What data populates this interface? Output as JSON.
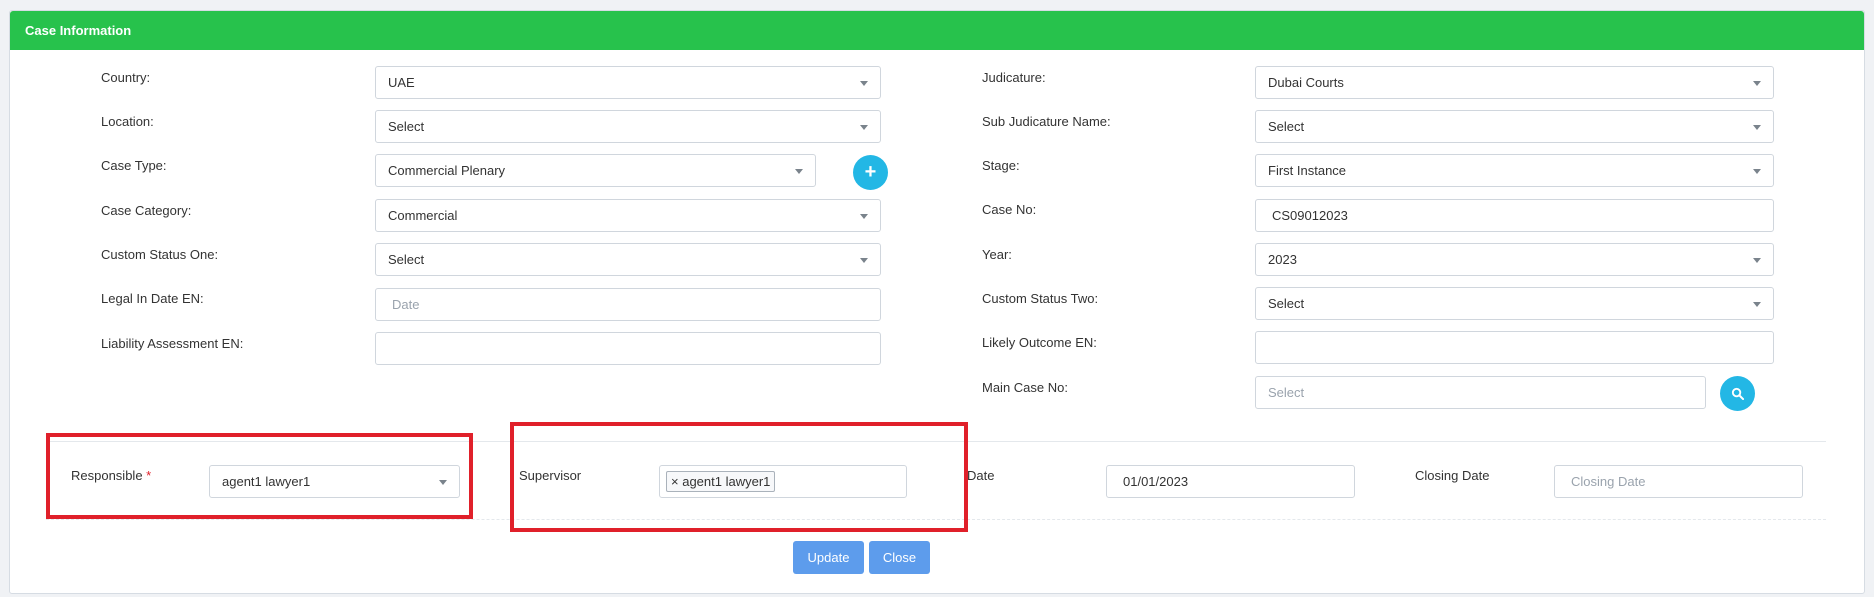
{
  "panel": {
    "title": "Case Information"
  },
  "left_fields": [
    {
      "label": "Country:",
      "value": "UAE",
      "type": "select"
    },
    {
      "label": "Location:",
      "value": "Select",
      "type": "select"
    },
    {
      "label": "Case Type:",
      "value": "Commercial Plenary",
      "type": "select"
    },
    {
      "label": "Case Category:",
      "value": "Commercial",
      "type": "select"
    },
    {
      "label": "Custom Status One:",
      "value": "Select",
      "type": "select"
    },
    {
      "label": "Legal In Date EN:",
      "placeholder": "Date",
      "type": "input"
    },
    {
      "label": "Liability Assessment EN:",
      "value": "",
      "type": "input"
    }
  ],
  "right_fields": [
    {
      "label": "Judicature:",
      "value": "Dubai Courts",
      "type": "select"
    },
    {
      "label": "Sub Judicature Name:",
      "value": "Select",
      "type": "select"
    },
    {
      "label": "Stage:",
      "value": "First Instance",
      "type": "select"
    },
    {
      "label": "Case No:",
      "value": "CS09012023",
      "type": "input"
    },
    {
      "label": "Year:",
      "value": "2023",
      "type": "select"
    },
    {
      "label": "Custom Status Two:",
      "value": "Select",
      "type": "select"
    },
    {
      "label": "Likely Outcome EN:",
      "value": "",
      "type": "input"
    },
    {
      "label": "Main Case No:",
      "placeholder": "Select",
      "type": "input"
    }
  ],
  "icons": {
    "add": "plus-icon",
    "add_glyph": "+",
    "search": "search-icon"
  },
  "bottom": {
    "responsible_label": "Responsible",
    "required_mark": "*",
    "responsible_value": "agent1 lawyer1",
    "supervisor_label": "Supervisor",
    "supervisor_tag_remove": "×",
    "supervisor_tag": "agent1 lawyer1",
    "date_label": "Date",
    "date_value": "01/01/2023",
    "closing_label": "Closing Date",
    "closing_placeholder": "Closing Date"
  },
  "buttons": {
    "update": "Update",
    "close": "Close"
  },
  "colors": {
    "header": "#27c24c",
    "accent": "#23b7e5",
    "button": "#5d9cec",
    "highlight": "#e0202a"
  }
}
